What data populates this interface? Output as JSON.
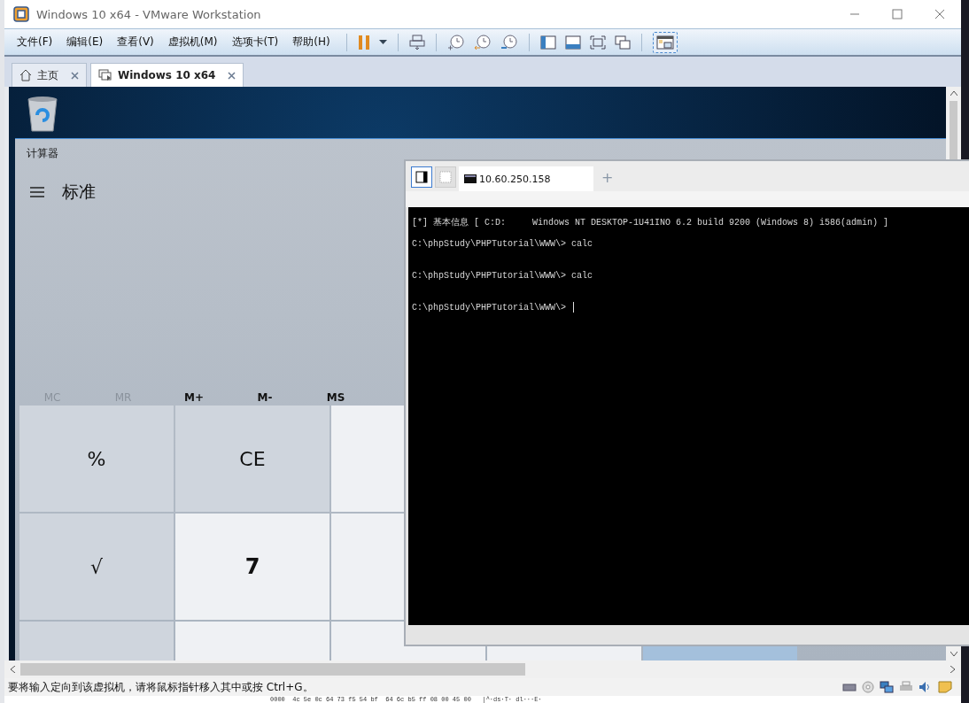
{
  "window": {
    "title": "Windows 10 x64 - VMware Workstation"
  },
  "menu": [
    {
      "label": "文件(F)"
    },
    {
      "label": "编辑(E)"
    },
    {
      "label": "查看(V)"
    },
    {
      "label": "虚拟机(M)"
    },
    {
      "label": "选项卡(T)"
    },
    {
      "label": "帮助(H)"
    }
  ],
  "tabs": [
    {
      "label": "主页",
      "kind": "home",
      "selected": false
    },
    {
      "label": "Windows 10 x64",
      "kind": "vm",
      "selected": true
    }
  ],
  "calculator": {
    "title": "计算器",
    "mode": "标准",
    "memory": [
      {
        "label": "MC",
        "disabled": true
      },
      {
        "label": "MR",
        "disabled": true
      },
      {
        "label": "M+",
        "disabled": false
      },
      {
        "label": "M-",
        "disabled": false
      },
      {
        "label": "MS",
        "disabled": false
      }
    ],
    "keys": [
      {
        "cells": [
          {
            "label": "%",
            "kind": "function"
          },
          {
            "label": "CE",
            "kind": "function"
          }
        ]
      },
      {
        "cells": [
          {
            "label": "√",
            "kind": "function"
          },
          {
            "label": "7",
            "kind": "digit"
          }
        ]
      }
    ]
  },
  "terminal": {
    "toggles": [
      {
        "on": true
      },
      {
        "on": false
      }
    ],
    "tabs": [
      {
        "label": "10.60.250.158",
        "selected": true
      }
    ],
    "new_tab": "+",
    "lines": [
      "[*] 基本信息 [ C:D:     Windows NT DESKTOP-1U41INO 6.2 build 9200 (Windows 8) i586(admin) ]",
      "C:\\phpStudy\\PHPTutorial\\WWW\\> calc",
      "C:\\phpStudy\\PHPTutorial\\WWW\\> calc",
      "C:\\phpStudy\\PHPTutorial\\WWW\\> "
    ]
  },
  "status_bar": {
    "message": "要将输入定向到该虚拟机，请将鼠标指针移入其中或按 Ctrl+G。"
  },
  "background_window": {
    "hex_line": "0000  4c 5e 0c 64 73 f5 54 bf  64 6c b5 ff 08 00 45 00   |^·ds·T· dl···E·"
  }
}
